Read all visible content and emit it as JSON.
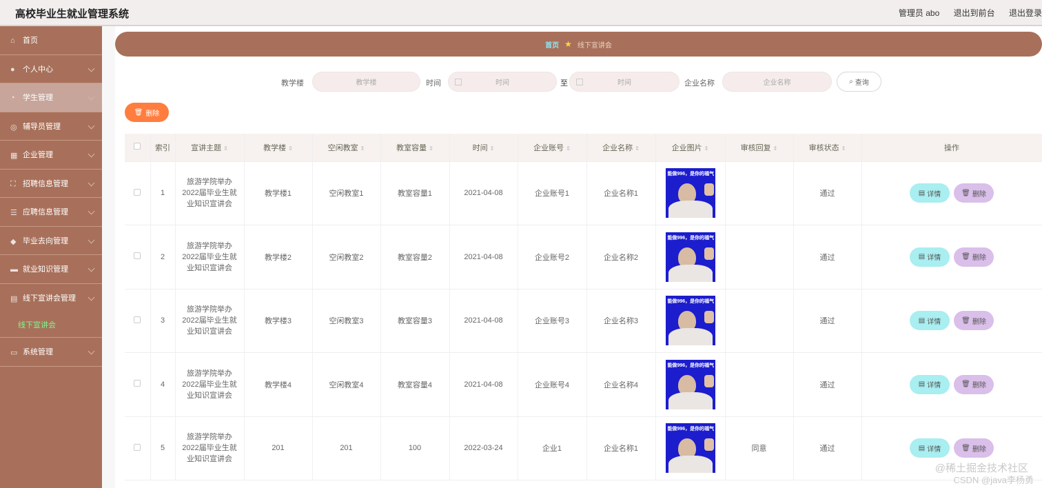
{
  "header": {
    "title": "高校毕业生就业管理系统",
    "admin": "管理员 abo",
    "to_front": "退出到前台",
    "logout": "退出登录"
  },
  "sidebar": {
    "items": [
      {
        "label": "首页",
        "icon": "home-icon"
      },
      {
        "label": "个人中心",
        "icon": "user-icon"
      },
      {
        "label": "学生管理",
        "icon": "clock-icon"
      },
      {
        "label": "辅导员管理",
        "icon": "dashboard-icon"
      },
      {
        "label": "企业管理",
        "icon": "grid-icon"
      },
      {
        "label": "招聘信息管理",
        "icon": "expand-icon"
      },
      {
        "label": "应聘信息管理",
        "icon": "list-icon"
      },
      {
        "label": "毕业去向管理",
        "icon": "shield-icon"
      },
      {
        "label": "就业知识管理",
        "icon": "briefcase-icon"
      },
      {
        "label": "线下宣讲会管理",
        "icon": "book-icon"
      },
      {
        "label": "系统管理",
        "icon": "window-icon"
      }
    ],
    "submenu": {
      "label": "线下宣讲会"
    }
  },
  "breadcrumb": {
    "home": "首页",
    "current": "线下宣讲会"
  },
  "search": {
    "building_label": "教学楼",
    "building_placeholder": "教学楼",
    "time_label": "时间",
    "time_start_placeholder": "时间",
    "to": "至",
    "time_end_placeholder": "时间",
    "company_label": "企业名称",
    "company_placeholder": "企业名称",
    "query_label": "查询"
  },
  "actions": {
    "batch_delete": "删除"
  },
  "table": {
    "headers": [
      "索引",
      "宣讲主题",
      "教学楼",
      "空闲教室",
      "教室容量",
      "时间",
      "企业账号",
      "企业名称",
      "企业图片",
      "审核回复",
      "审核状态",
      "操作"
    ],
    "rows": [
      {
        "index": "1",
        "topic": "旅游学院举办2022届毕业生就业知识宣讲会",
        "building": "教学楼1",
        "room": "空闲教室1",
        "capacity": "教室容量1",
        "time": "2021-04-08",
        "account": "企业账号1",
        "company": "企业名称1",
        "pic_caption": "能做996，是你的福气",
        "reply": "",
        "status": "通过",
        "detail": "详情",
        "delete": "删除"
      },
      {
        "index": "2",
        "topic": "旅游学院举办2022届毕业生就业知识宣讲会",
        "building": "教学楼2",
        "room": "空闲教室2",
        "capacity": "教室容量2",
        "time": "2021-04-08",
        "account": "企业账号2",
        "company": "企业名称2",
        "pic_caption": "能做996，是你的福气",
        "reply": "",
        "status": "通过",
        "detail": "详情",
        "delete": "删除"
      },
      {
        "index": "3",
        "topic": "旅游学院举办2022届毕业生就业知识宣讲会",
        "building": "教学楼3",
        "room": "空闲教室3",
        "capacity": "教室容量3",
        "time": "2021-04-08",
        "account": "企业账号3",
        "company": "企业名称3",
        "pic_caption": "能做996，是你的福气",
        "reply": "",
        "status": "通过",
        "detail": "详情",
        "delete": "删除"
      },
      {
        "index": "4",
        "topic": "旅游学院举办2022届毕业生就业知识宣讲会",
        "building": "教学楼4",
        "room": "空闲教室4",
        "capacity": "教室容量4",
        "time": "2021-04-08",
        "account": "企业账号4",
        "company": "企业名称4",
        "pic_caption": "能做996，是你的福气",
        "reply": "",
        "status": "通过",
        "detail": "详情",
        "delete": "删除"
      },
      {
        "index": "5",
        "topic": "旅游学院举办2022届毕业生就业知识宣讲会",
        "building": "201",
        "room": "201",
        "capacity": "100",
        "time": "2022-03-24",
        "account": "企业1",
        "company": "企业名称1",
        "pic_caption": "能做996，是你的福气",
        "reply": "同意",
        "status": "通过",
        "detail": "详情",
        "delete": "删除"
      }
    ]
  },
  "watermark": {
    "line1": "@稀土掘金技术社区",
    "line2": "CSDN @java李杨勇"
  }
}
